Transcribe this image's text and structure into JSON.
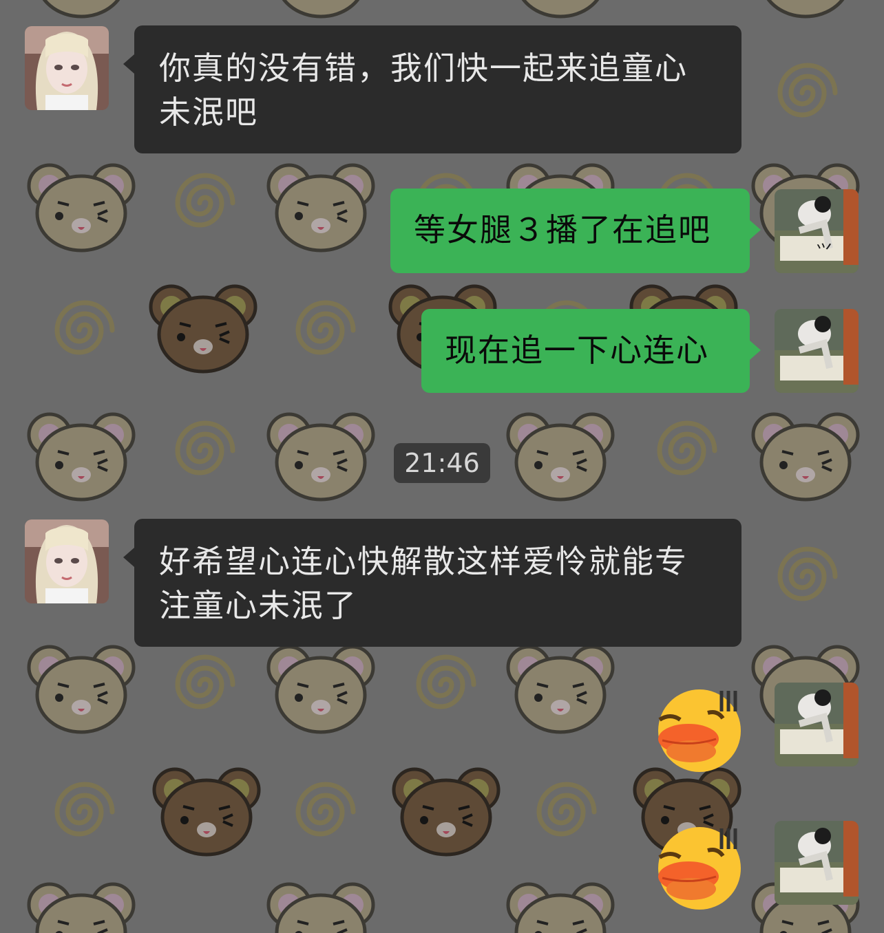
{
  "chat": {
    "timestamp": "21:46",
    "messages": [
      {
        "side": "in",
        "text": "你真的没有错，我们快一起来追童心未泯吧"
      },
      {
        "side": "out",
        "text": "等女腿３播了在追吧"
      },
      {
        "side": "out",
        "text": "现在追一下心连心"
      },
      {
        "side": "in",
        "text": "好希望心连心快解散这样爱怜就能专注童心未泯了"
      },
      {
        "side": "out",
        "sticker": "duck-face-sticker"
      },
      {
        "side": "out",
        "sticker": "duck-face-sticker"
      }
    ]
  },
  "colors": {
    "background": "#6b6b6b",
    "incoming_bubble": "#2b2b2b",
    "outgoing_bubble": "#3bb356",
    "timestamp_bg": "#3a3a3a"
  },
  "icons": {
    "wallpaper": "bear-face-pattern",
    "wallpaper_swirl": "swirl-icon",
    "incoming_avatar": "blonde-girl-avatar",
    "outgoing_avatar": "calligraphy-photo-avatar"
  }
}
